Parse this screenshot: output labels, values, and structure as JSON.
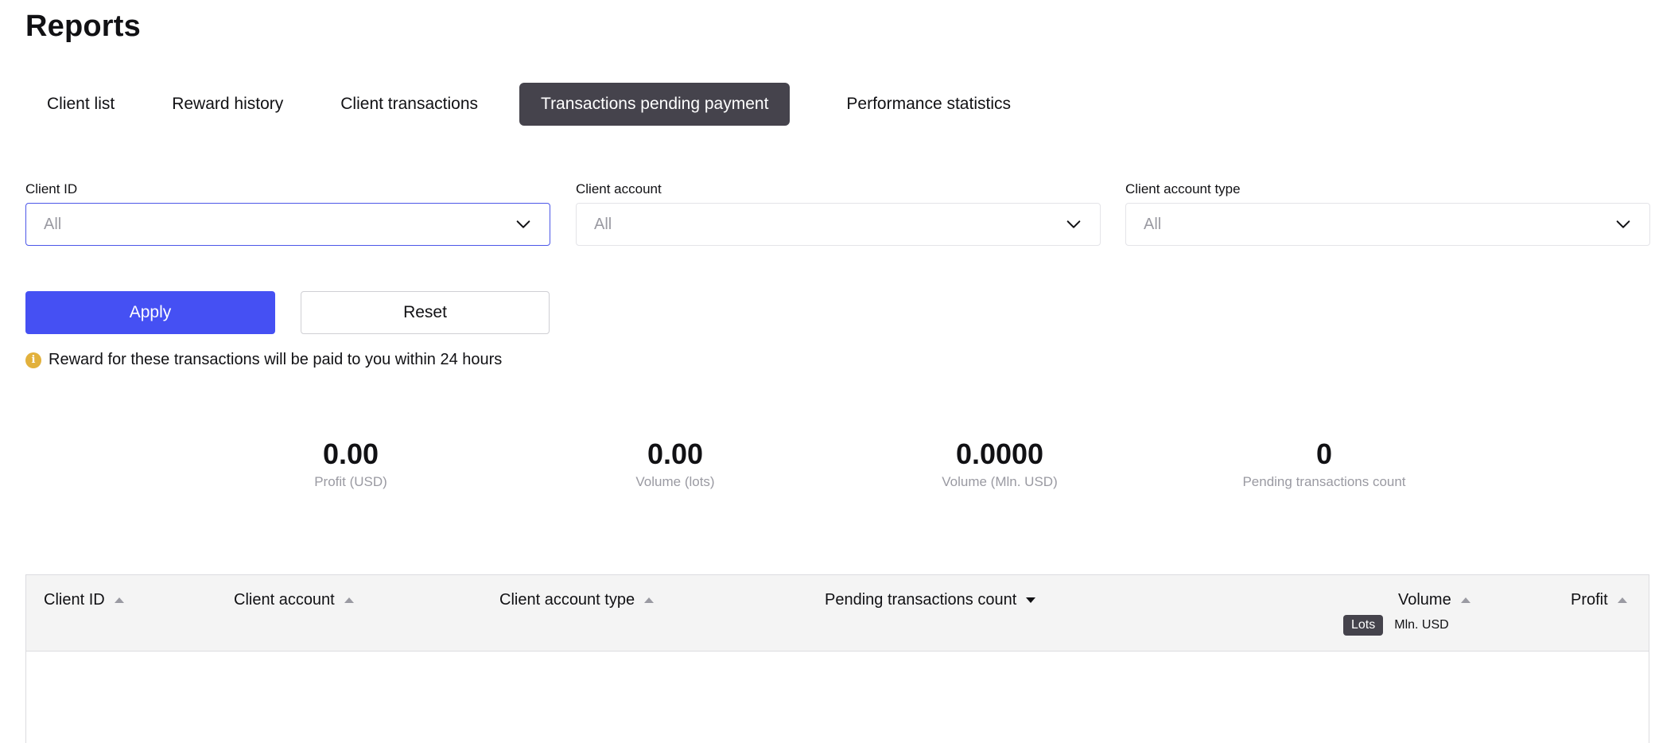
{
  "page": {
    "title": "Reports"
  },
  "tabs": [
    {
      "label": "Client list",
      "active": false
    },
    {
      "label": "Reward history",
      "active": false
    },
    {
      "label": "Client transactions",
      "active": false
    },
    {
      "label": "Transactions pending payment",
      "active": true
    },
    {
      "label": "Performance statistics",
      "active": false
    }
  ],
  "filters": {
    "client_id": {
      "label": "Client ID",
      "value": "All"
    },
    "client_account": {
      "label": "Client account",
      "value": "All"
    },
    "client_account_type": {
      "label": "Client account type",
      "value": "All"
    }
  },
  "actions": {
    "apply_label": "Apply",
    "reset_label": "Reset"
  },
  "notice": {
    "text": "Reward for these transactions will be paid to you within 24 hours",
    "icon": "info-icon",
    "icon_glyph": "i",
    "icon_color": "#e2b13c"
  },
  "stats": [
    {
      "value": "0.00",
      "label": "Profit (USD)"
    },
    {
      "value": "0.00",
      "label": "Volume (lots)"
    },
    {
      "value": "0.0000",
      "label": "Volume (Mln. USD)"
    },
    {
      "value": "0",
      "label": "Pending transactions count"
    }
  ],
  "table": {
    "columns": [
      {
        "label": "Client ID",
        "sort": "asc"
      },
      {
        "label": "Client account",
        "sort": "asc"
      },
      {
        "label": "Client account type",
        "sort": "asc"
      },
      {
        "label": "Pending transactions count",
        "sort": "desc"
      },
      {
        "label": "Volume",
        "sort": "asc"
      },
      {
        "label": "Profit",
        "sort": "asc"
      }
    ],
    "volume_units": {
      "lots": "Lots",
      "mln_usd": "Mln. USD",
      "selected": "Lots"
    },
    "rows": []
  },
  "colors": {
    "accent": "#4550f3",
    "dark": "#45434c",
    "focus_border": "#4c57e8",
    "muted_text": "#9a9aa2"
  }
}
